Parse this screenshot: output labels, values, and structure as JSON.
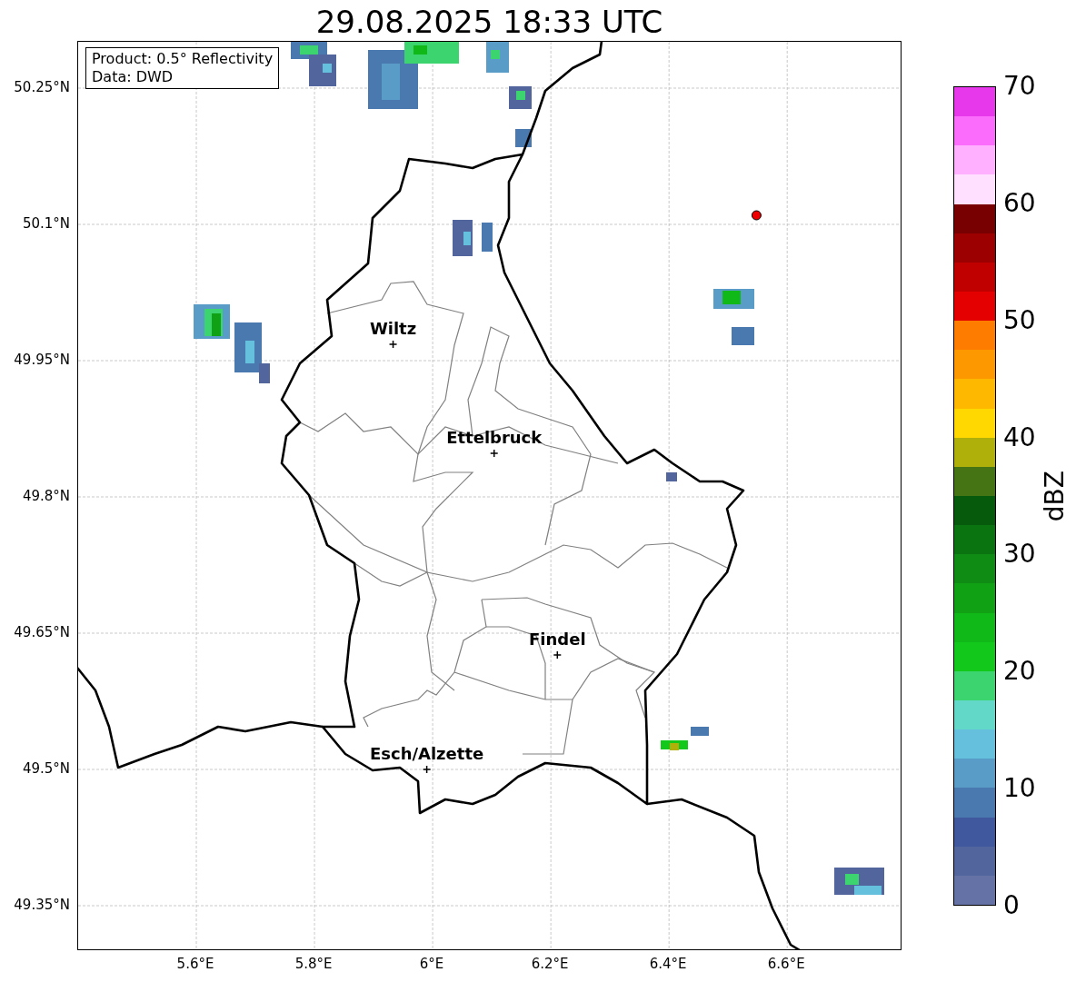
{
  "title": "29.08.2025 18:33 UTC",
  "info_box": [
    "Product: 0.5° Reflectivity",
    "Data: DWD"
  ],
  "xticks": [
    "5.6°E",
    "5.8°E",
    "6°E",
    "6.2°E",
    "6.4°E",
    "6.6°E"
  ],
  "yticks": [
    "50.25°N",
    "50.1°N",
    "49.95°N",
    "49.8°N",
    "49.65°N",
    "49.5°N",
    "49.35°N"
  ],
  "cities": [
    "Wiltz",
    "Ettelbruck",
    "Findel",
    "Esch/Alzette"
  ],
  "colorbar": {
    "label": "dBZ",
    "ticks": [
      "70",
      "60",
      "50",
      "40",
      "30",
      "20",
      "10",
      "0"
    ]
  }
}
